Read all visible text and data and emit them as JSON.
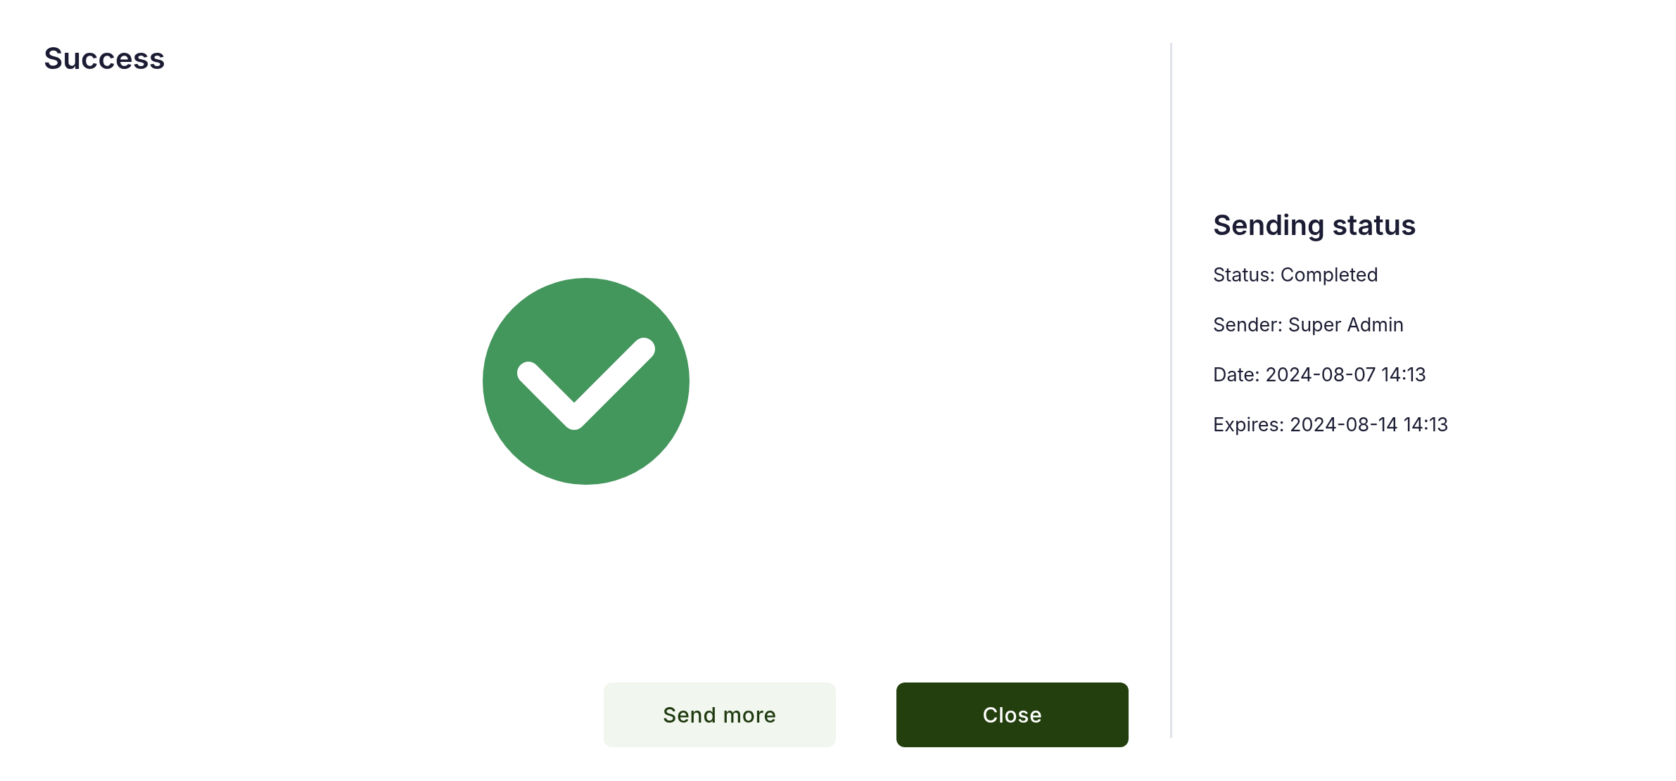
{
  "title": "Success",
  "sending_status": {
    "heading": "Sending status",
    "lines": [
      "Status: Completed",
      "Sender: Super Admin",
      "Date: 2024-08-07 14:13",
      "Expires: 2024-08-14 14:13"
    ]
  },
  "buttons": [
    {
      "label": "Send more",
      "kind": "secondary"
    },
    {
      "label": "Close",
      "kind": "primary"
    }
  ]
}
